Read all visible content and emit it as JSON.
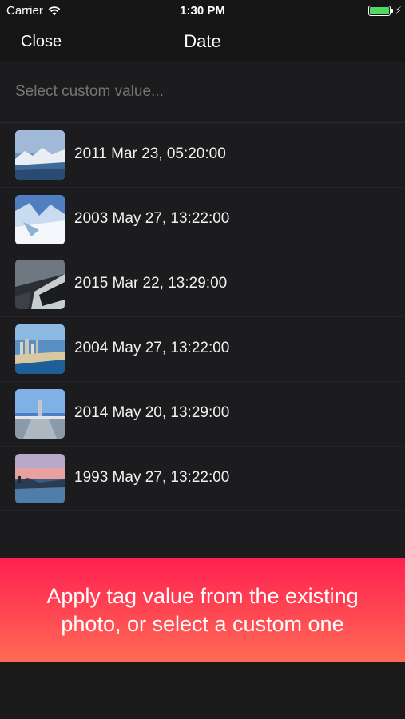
{
  "status_bar": {
    "carrier": "Carrier",
    "time": "1:30 PM",
    "battery_level": 1.0,
    "battery_color": "#4cd964"
  },
  "nav": {
    "close_label": "Close",
    "title": "Date"
  },
  "custom_value": {
    "placeholder": "Select custom value...",
    "value": ""
  },
  "dates": [
    {
      "label": "2011 Mar 23, 05:20:00",
      "thumb": "snowy-mountains-icon"
    },
    {
      "label": "2003 May 27, 13:22:00",
      "thumb": "glacier-icon"
    },
    {
      "label": "2015 Mar 22, 13:29:00",
      "thumb": "car-road-icon"
    },
    {
      "label": "2004 May 27, 13:22:00",
      "thumb": "coastline-city-icon"
    },
    {
      "label": "2014 May 20, 13:29:00",
      "thumb": "pier-icon"
    },
    {
      "label": "1993 May 27, 13:22:00",
      "thumb": "sunset-coast-icon"
    }
  ],
  "banner": {
    "text": "Apply tag value from the existing photo, or select a custom one",
    "color_top": "#ff2050",
    "color_bottom": "#ff6a55"
  }
}
